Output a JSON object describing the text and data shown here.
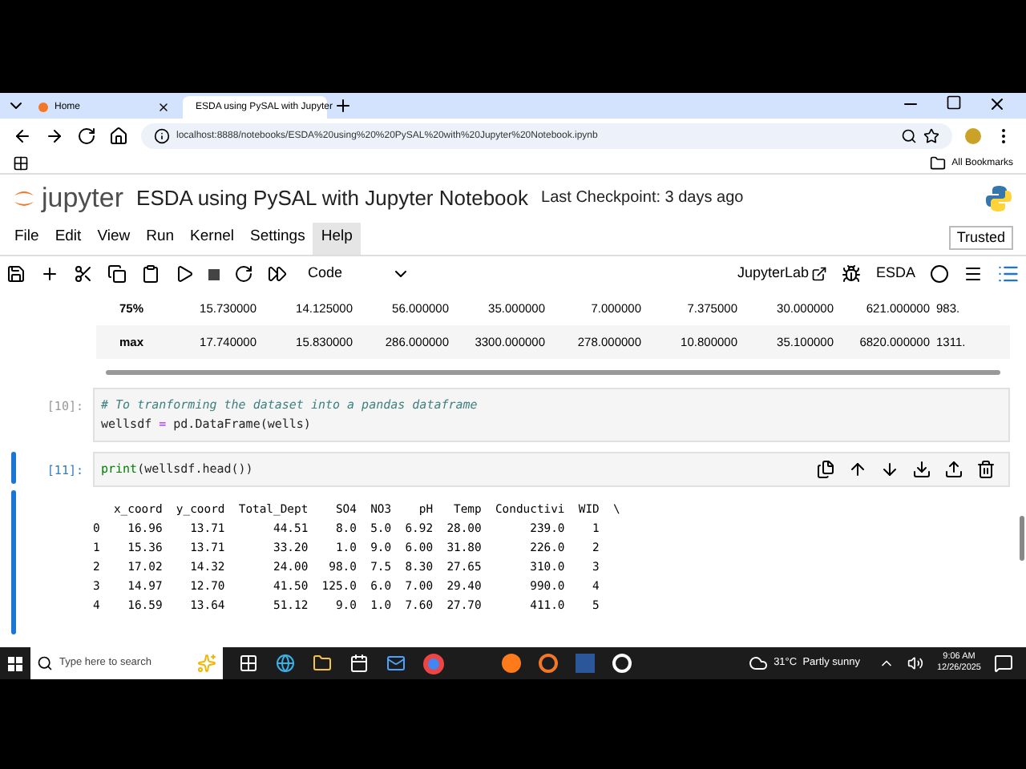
{
  "browser": {
    "tabs": [
      {
        "label": "Home",
        "selected": false
      },
      {
        "label": "ESDA using PySAL with Jupyter",
        "selected": true
      }
    ],
    "url": "localhost:8888/notebooks/ESDA%20using%20%20PySAL%20with%20Jupyter%20Notebook.ipynb",
    "bookmarks_label": "All Bookmarks"
  },
  "notebook": {
    "logo_text": "jupyter",
    "title": "ESDA using PySAL with Jupyter Notebook",
    "checkpoint": "Last Checkpoint: 3 days ago",
    "menu": [
      {
        "label": "File",
        "selected": false
      },
      {
        "label": "Edit",
        "selected": false
      },
      {
        "label": "View",
        "selected": false
      },
      {
        "label": "Run",
        "selected": false
      },
      {
        "label": "Kernel",
        "selected": false
      },
      {
        "label": "Settings",
        "selected": false
      },
      {
        "label": "Help",
        "selected": true
      }
    ],
    "trusted": "Trusted",
    "cell_type": "Code",
    "jupyterlab": "JupyterLab",
    "kernel": "ESDA",
    "table_rows": [
      {
        "label": "75%",
        "values": [
          "15.730000",
          "14.125000",
          "56.000000",
          "35.000000",
          "7.000000",
          "7.375000",
          "30.000000",
          "621.000000",
          "983."
        ]
      },
      {
        "label": "max",
        "values": [
          "17.740000",
          "15.830000",
          "286.000000",
          "3300.000000",
          "278.000000",
          "10.800000",
          "35.100000",
          "6820.000000",
          "1311."
        ]
      }
    ],
    "cells": [
      {
        "prompt": "[10]:",
        "selected": false,
        "lines": [
          [
            {
              "t": "# To tranforming the dataset into a pandas dataframe",
              "kind": "comment"
            }
          ],
          [
            {
              "t": "wellsdf ",
              "kind": "plain"
            },
            {
              "t": "=",
              "kind": "op"
            },
            {
              "t": " pd.DataFrame(wells)",
              "kind": "plain"
            }
          ]
        ]
      },
      {
        "prompt": "[11]:",
        "selected": true,
        "lines": [
          [
            {
              "t": "print",
              "kind": "builtin"
            },
            {
              "t": "(wellsdf.head())",
              "kind": "plain"
            }
          ]
        ]
      }
    ],
    "output": [
      "   x_coord  y_coord  Total_Dept    SO4  NO3    pH   Temp  Conductivi  WID  \\",
      "0    16.96    13.71       44.51    8.0  5.0  6.92  28.00       239.0    1",
      "1    15.36    13.71       33.20    1.0  9.0  6.00  31.80       226.0    2",
      "2    17.02    14.32       24.00   98.0  7.5  8.30  27.65       310.0    3",
      "3    14.97    12.70       41.50  125.0  6.0  7.00  29.40       990.0    4",
      "4    16.59    13.64       51.12    9.0  1.0  7.60  27.70       411.0    5"
    ]
  },
  "taskbar": {
    "search_placeholder": "Type here to search",
    "weather": "31°C  Partly sunny",
    "time": "9:06 AM",
    "date": "12/26/2025"
  }
}
